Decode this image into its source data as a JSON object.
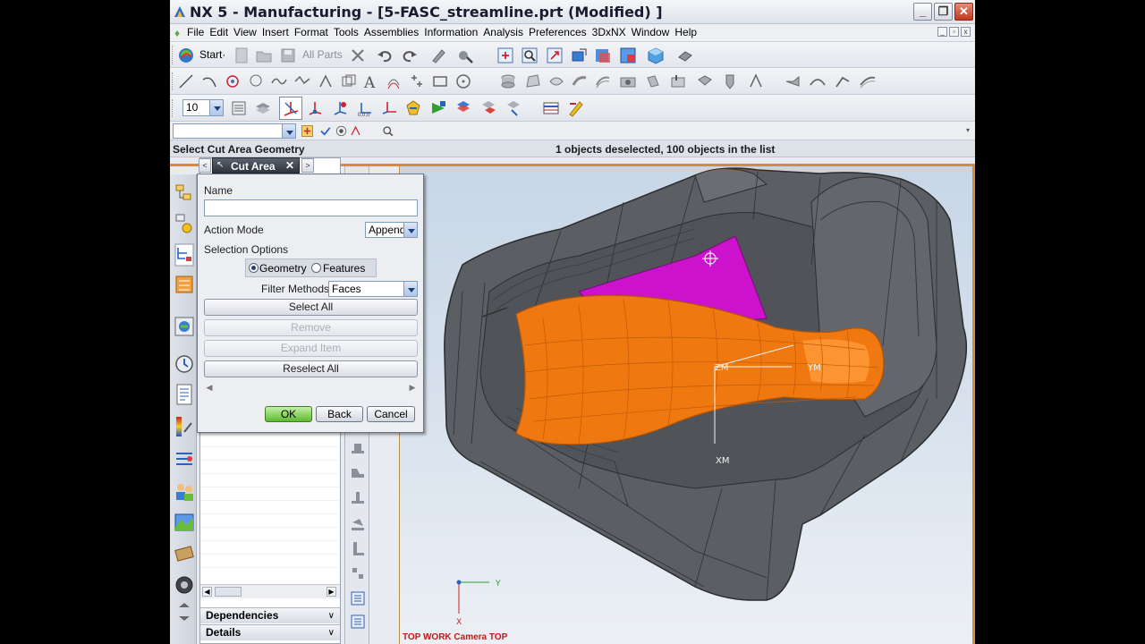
{
  "window": {
    "title": "NX 5 - Manufacturing - [5-FASC_streamline.prt (Modified) ]",
    "controls": {
      "minimize": "_",
      "maximize": "❐",
      "close": "✕"
    }
  },
  "menu": {
    "items": [
      "File",
      "Edit",
      "View",
      "Insert",
      "Format",
      "Tools",
      "Assemblies",
      "Information",
      "Analysis",
      "Preferences",
      "3DxNX",
      "Window",
      "Help"
    ]
  },
  "toolbar": {
    "start_label": "Start·",
    "all_parts_label": "All Parts",
    "layer_value": "10",
    "selection_filter_value": ""
  },
  "cue_line": {
    "prompt": "Select Cut Area Geometry",
    "status": "1 objects deselected, 100 objects in the list"
  },
  "navigator": {
    "sections": [
      "Dependencies",
      "Details"
    ]
  },
  "dialog": {
    "title": "Cut Area",
    "name_label": "Name",
    "name_value": "",
    "action_mode_label": "Action Mode",
    "action_mode_value": "Append",
    "selection_options_label": "Selection Options",
    "radio_geometry": "Geometry",
    "radio_features": "Features",
    "selected_radio": "Geometry",
    "filter_methods_label": "Filter Methods",
    "filter_methods_value": "Faces",
    "select_all": "Select All",
    "remove": "Remove",
    "expand_item": "Expand Item",
    "reselect_all": "Reselect All",
    "ok": "OK",
    "back": "Back",
    "cancel": "Cancel"
  },
  "viewport": {
    "view_label": "TOP WORK Camera TOP",
    "axis_labels": {
      "zm": "ZM",
      "ym": "YM",
      "xm": "XM",
      "y": "Y",
      "x": "X"
    },
    "colors": {
      "part": "#5c5e62",
      "cut_area": "#f07810",
      "highlight": "#cc12cc",
      "accent": "#d88a3a"
    }
  }
}
